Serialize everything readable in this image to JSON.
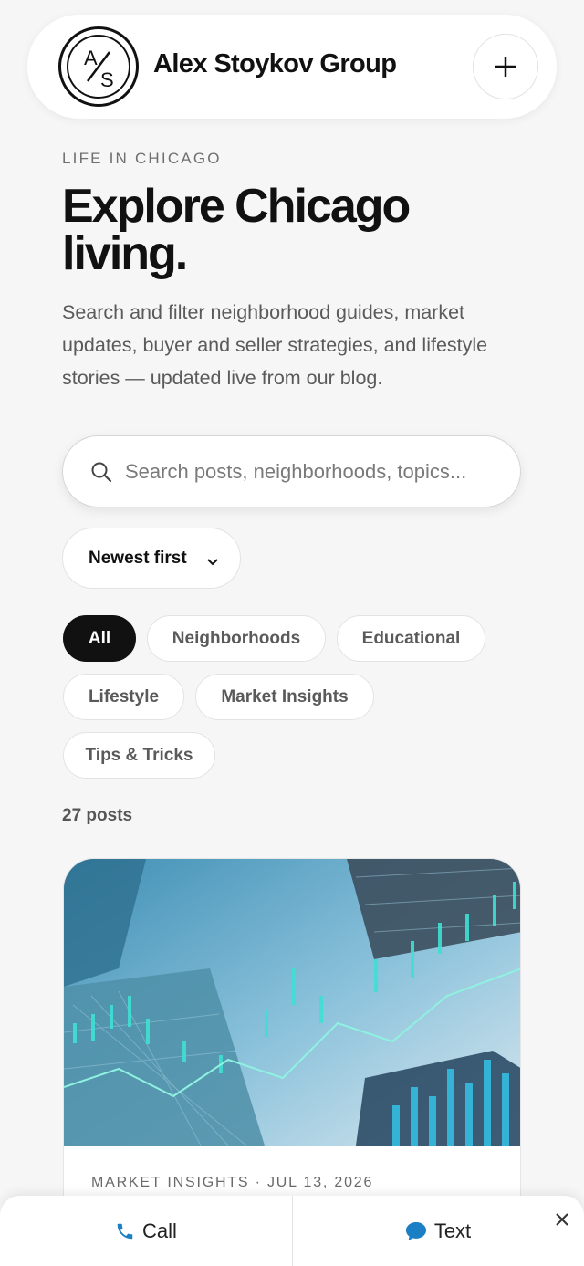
{
  "header": {
    "logo_top": "A",
    "logo_bottom": "S",
    "brand": "Alex Stoykov Group"
  },
  "hero": {
    "eyebrow": "LIFE IN CHICAGO",
    "title_line1": "Explore Chicago",
    "title_line2": "living.",
    "intro": "Search and filter neighborhood guides, market updates, buyer and seller strategies, and lifestyle stories — updated live from our blog."
  },
  "search": {
    "placeholder": "Search posts, neighborhoods, topics...",
    "value": ""
  },
  "sort": {
    "selected": "Newest first"
  },
  "filters": [
    {
      "label": "All",
      "active": true
    },
    {
      "label": "Neighborhoods",
      "active": false
    },
    {
      "label": "Educational",
      "active": false
    },
    {
      "label": "Lifestyle",
      "active": false
    },
    {
      "label": "Market Insights",
      "active": false
    },
    {
      "label": "Tips & Tricks",
      "active": false
    }
  ],
  "results": {
    "count_label": "27 posts"
  },
  "post": {
    "meta": "MARKET INSIGHTS · JUL 13, 2026"
  },
  "bottom_bar": {
    "call_label": "Call",
    "text_label": "Text"
  },
  "colors": {
    "accent": "#1a7fc4",
    "active_chip": "#111111",
    "background": "#f6f6f6"
  },
  "icons": [
    "search-icon",
    "plus-icon",
    "chevron-down-icon",
    "phone-icon",
    "chat-bubble-icon",
    "close-icon"
  ]
}
